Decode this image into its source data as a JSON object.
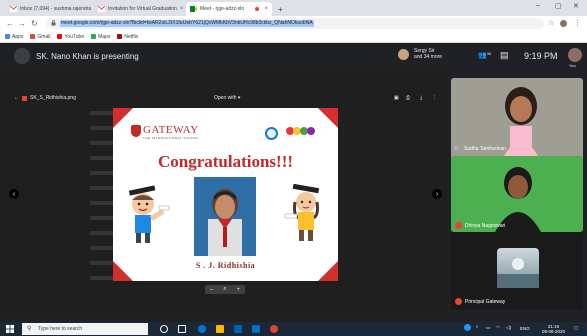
{
  "browser": {
    "tabs": [
      {
        "label": "Inbox (7,094) - sushma.rajendra",
        "icon": "gmail-icon",
        "active": false
      },
      {
        "label": "Invitation for Virtual Graduation",
        "icon": "gmail-icon",
        "active": false
      },
      {
        "label": "Meet - rjge-adzz-xln",
        "icon": "meet-icon",
        "active": true
      }
    ],
    "new_tab": "+",
    "url": "meet.google.com/rjge-adzz-xln?fbclid=IwAR2oiL2tX1fuIJebY621jQcWMkKbV3nbUHc98b3ckbz_QNahNOkuobNA",
    "bookmarks": [
      "Apps",
      "Gmail",
      "YouTube",
      "Maps",
      "Netflix"
    ],
    "window_controls": [
      "–",
      "▢",
      "✕"
    ]
  },
  "meet": {
    "presenting_text": "SK. Nano Khan is presenting",
    "host": {
      "name": "Sergy Sir",
      "more": "and 34 more"
    },
    "people_count": "35",
    "time": "9:19 PM",
    "me_label": "You"
  },
  "viewer": {
    "file_name": "SK_S_Ridhishia.png",
    "open_with": "Open with ▾",
    "zoom_minus": "–",
    "zoom_plus": "+"
  },
  "slide": {
    "school": "GATEWAY",
    "school_sub": "THE INTERNATIONAL SCHOOL",
    "heading": "Congratulations!!!",
    "student_name": "S . J. Ridhishia",
    "colors": {
      "accent": "#d32f2f",
      "heading": "#c62828",
      "name": "#8e2c1f"
    }
  },
  "participants": [
    {
      "name": "Sudha Tamilselvan",
      "muted": false,
      "bg": "#9e9e95"
    },
    {
      "name": "Dhivya Nageswari",
      "muted": true,
      "bg": "#4caf50"
    },
    {
      "name": "Principal Gateway",
      "muted": true,
      "bg": "#1a1a1a"
    }
  ],
  "taskbar": {
    "search_placeholder": "Type here to search",
    "time": "21:19",
    "date": "09-06-2020",
    "lang": "ENG"
  }
}
